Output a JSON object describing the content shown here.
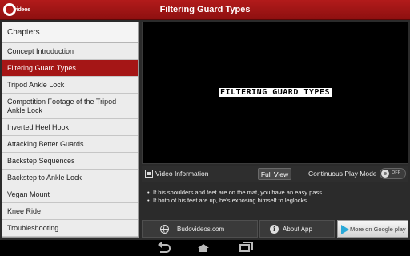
{
  "app": {
    "title": "Filtering Guard Types",
    "logo_text": "videos"
  },
  "sidebar": {
    "header": "Chapters",
    "items": [
      {
        "label": "Concept Introduction",
        "active": false
      },
      {
        "label": "Filtering Guard Types",
        "active": true
      },
      {
        "label": "Tripod Ankle Lock",
        "active": false
      },
      {
        "label": "Competition Footage of the Tripod Ankle Lock",
        "active": false
      },
      {
        "label": "Inverted Heel Hook",
        "active": false
      },
      {
        "label": "Attacking Better Guards",
        "active": false
      },
      {
        "label": "Backstep Sequences",
        "active": false
      },
      {
        "label": "Backstep to Ankle Lock",
        "active": false
      },
      {
        "label": "Vegan Mount",
        "active": false
      },
      {
        "label": "Knee Ride",
        "active": false
      },
      {
        "label": "Troubleshooting",
        "active": false
      }
    ]
  },
  "video": {
    "caption": "FILTERING GUARD TYPES"
  },
  "infobar": {
    "label": "Video Information",
    "full_view": "Full View",
    "continuous_label": "Continuous Play Mode",
    "toggle_state": "OFF"
  },
  "description": [
    "If his shoulders and feet are on the mat, you have an easy pass.",
    "If both of his feet are up, he's exposing himself to leglocks."
  ],
  "buttons": {
    "website": "Budovideos.com",
    "about": "About App",
    "google_play": "More on Google play"
  },
  "colors": {
    "accent": "#a51616",
    "title_bar": "#b21b1b"
  }
}
